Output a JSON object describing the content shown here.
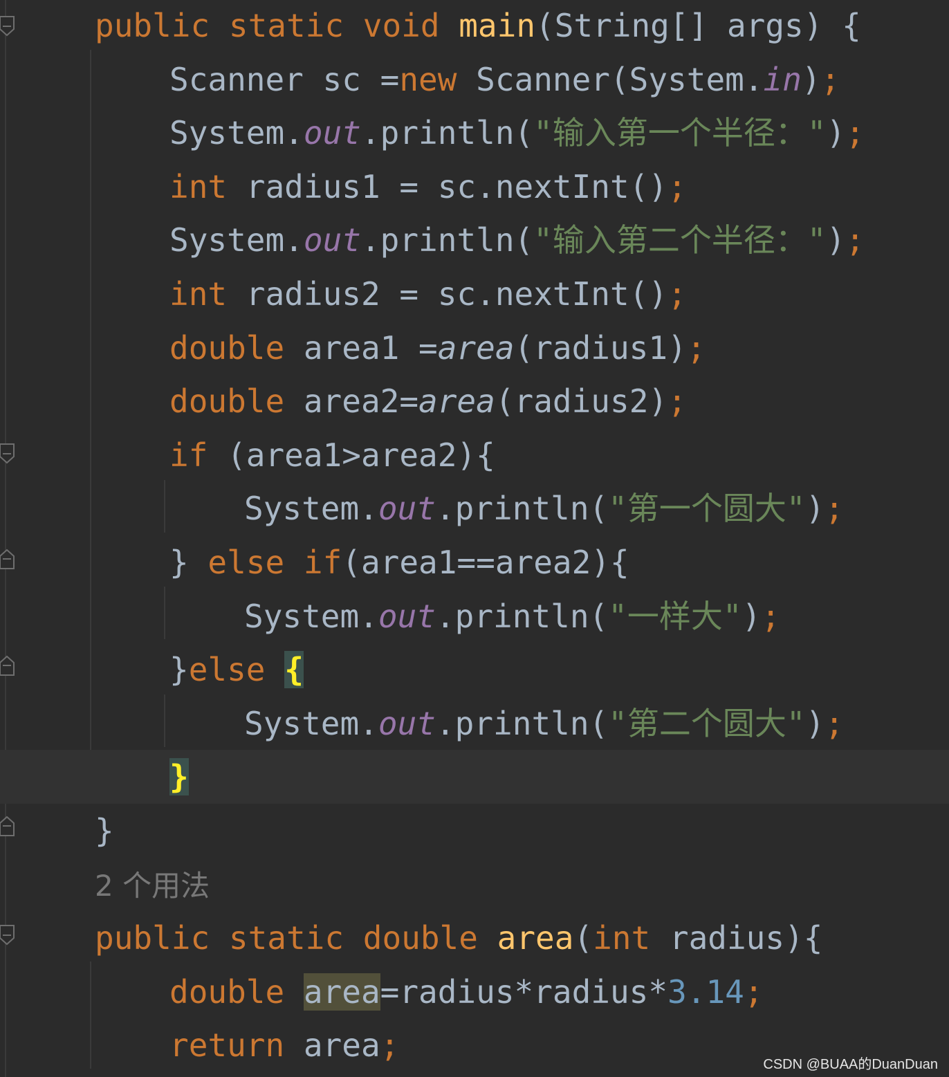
{
  "editor": {
    "lines": [
      {
        "tokens": [
          [
            "public",
            "kw"
          ],
          [
            " ",
            ""
          ],
          [
            "static",
            "kw"
          ],
          [
            " ",
            ""
          ],
          [
            "void",
            "kw"
          ],
          [
            " ",
            ""
          ],
          [
            "main",
            "fn"
          ],
          [
            "(String[] args) {",
            ""
          ]
        ]
      },
      {
        "tokens": [
          [
            "Scanner sc =",
            ""
          ],
          [
            "new",
            "kw"
          ],
          [
            " Scanner(System.",
            ""
          ],
          [
            "in",
            "fld"
          ],
          [
            ")",
            ""
          ],
          [
            ";",
            "punc"
          ]
        ]
      },
      {
        "tokens": [
          [
            "System.",
            ""
          ],
          [
            "out",
            "fld"
          ],
          [
            ".println(",
            ""
          ],
          [
            "\"输入第一个半径：\"",
            "str"
          ],
          [
            ")",
            ""
          ],
          [
            ";",
            "punc"
          ]
        ]
      },
      {
        "tokens": [
          [
            "int",
            "kw"
          ],
          [
            " radius1 = sc.nextInt()",
            ""
          ],
          [
            ";",
            "punc"
          ]
        ]
      },
      {
        "tokens": [
          [
            "System.",
            ""
          ],
          [
            "out",
            "fld"
          ],
          [
            ".println(",
            ""
          ],
          [
            "\"输入第二个半径：\"",
            "str"
          ],
          [
            ")",
            ""
          ],
          [
            ";",
            "punc"
          ]
        ]
      },
      {
        "tokens": [
          [
            "int",
            "kw"
          ],
          [
            " radius2 = sc.nextInt()",
            ""
          ],
          [
            ";",
            "punc"
          ]
        ]
      },
      {
        "tokens": [
          [
            "double",
            "kw"
          ],
          [
            " area1 =",
            ""
          ],
          [
            "area",
            "stat"
          ],
          [
            "(radius1)",
            ""
          ],
          [
            ";",
            "punc"
          ]
        ]
      },
      {
        "tokens": [
          [
            "double",
            "kw"
          ],
          [
            " area2=",
            ""
          ],
          [
            "area",
            "stat"
          ],
          [
            "(radius2)",
            ""
          ],
          [
            ";",
            "punc"
          ]
        ]
      },
      {
        "tokens": [
          [
            "if",
            "kw"
          ],
          [
            " (area1>area2){",
            ""
          ]
        ]
      },
      {
        "tokens": [
          [
            "System.",
            ""
          ],
          [
            "out",
            "fld"
          ],
          [
            ".println(",
            ""
          ],
          [
            "\"第一个圆大\"",
            "str"
          ],
          [
            ")",
            ""
          ],
          [
            ";",
            "punc"
          ]
        ]
      },
      {
        "tokens": [
          [
            "} ",
            ""
          ],
          [
            "else",
            "kw"
          ],
          [
            " ",
            ""
          ],
          [
            "if",
            "kw"
          ],
          [
            "(area1==area2){",
            ""
          ]
        ]
      },
      {
        "tokens": [
          [
            "System.",
            ""
          ],
          [
            "out",
            "fld"
          ],
          [
            ".println(",
            ""
          ],
          [
            "\"一样大\"",
            "str"
          ],
          [
            ")",
            ""
          ],
          [
            ";",
            "punc"
          ]
        ]
      },
      {
        "tokens": [
          [
            "}",
            ""
          ],
          [
            "else",
            "kw"
          ],
          [
            " ",
            ""
          ],
          [
            "{",
            "brace-hl"
          ]
        ]
      },
      {
        "tokens": [
          [
            "System.",
            ""
          ],
          [
            "out",
            "fld"
          ],
          [
            ".println(",
            ""
          ],
          [
            "\"第二个圆大\"",
            "str"
          ],
          [
            ")",
            ""
          ],
          [
            ";",
            "punc"
          ]
        ]
      },
      {
        "tokens": [
          [
            "}",
            "brace-hl"
          ]
        ]
      },
      {
        "tokens": [
          [
            "}",
            ""
          ]
        ]
      },
      {
        "tokens": [
          [
            "2 个用法",
            "hint"
          ]
        ]
      },
      {
        "tokens": [
          [
            "public",
            "kw"
          ],
          [
            " ",
            ""
          ],
          [
            "static",
            "kw"
          ],
          [
            " ",
            ""
          ],
          [
            "double",
            "kw"
          ],
          [
            " ",
            ""
          ],
          [
            "area",
            "fn"
          ],
          [
            "(",
            ""
          ],
          [
            "int",
            "kw"
          ],
          [
            " radius){",
            ""
          ]
        ]
      },
      {
        "tokens": [
          [
            "double",
            "kw"
          ],
          [
            " ",
            ""
          ],
          [
            "area",
            "var-hl"
          ],
          [
            "=radius*radius*",
            ""
          ],
          [
            "3.14",
            "num"
          ],
          [
            ";",
            "punc"
          ]
        ]
      },
      {
        "tokens": [
          [
            "return",
            "kw"
          ],
          [
            " area",
            ""
          ],
          [
            ";",
            "punc"
          ]
        ]
      }
    ]
  },
  "watermark": "CSDN @BUAA的DuanDuan"
}
